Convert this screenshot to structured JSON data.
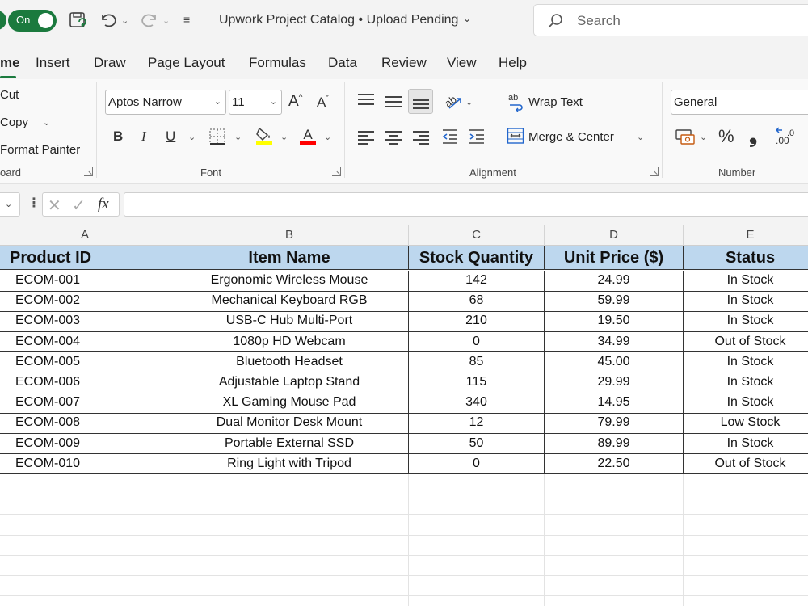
{
  "titlebar": {
    "autosave_label": "On",
    "doc_title": "Upwork Project Catalog",
    "doc_status": "Upload Pending",
    "search_placeholder": "Search"
  },
  "menu": {
    "tabs": [
      "me",
      "Insert",
      "Draw",
      "Page Layout",
      "Formulas",
      "Data",
      "Review",
      "View",
      "Help"
    ]
  },
  "ribbon": {
    "clipboard": {
      "cut": "Cut",
      "copy": "Copy",
      "format_painter": "Format Painter",
      "group_label": "oard"
    },
    "font": {
      "family": "Aptos Narrow",
      "size": "11",
      "bold": "B",
      "italic": "I",
      "underline": "U",
      "group_label": "Font",
      "highlight_color": "#ffff00",
      "font_color": "#ff0000"
    },
    "alignment": {
      "wrap_text": "Wrap Text",
      "merge_center": "Merge & Center",
      "group_label": "Alignment"
    },
    "number": {
      "format": "General",
      "percent": "%",
      "comma": "❟",
      "group_label": "Number"
    }
  },
  "formula_bar": {
    "fx": "fx",
    "value": ""
  },
  "sheet": {
    "column_letters": [
      "A",
      "B",
      "C",
      "D",
      "E"
    ],
    "headers": [
      "Product ID",
      "Item Name",
      "Stock Quantity",
      "Unit Price ($)",
      "Status"
    ],
    "rows": [
      [
        "ECOM-001",
        "Ergonomic Wireless Mouse",
        "142",
        "24.99",
        "In Stock"
      ],
      [
        "ECOM-002",
        "Mechanical Keyboard RGB",
        "68",
        "59.99",
        "In Stock"
      ],
      [
        "ECOM-003",
        "USB-C Hub Multi-Port",
        "210",
        "19.50",
        "In Stock"
      ],
      [
        "ECOM-004",
        "1080p HD Webcam",
        "0",
        "34.99",
        "Out of Stock"
      ],
      [
        "ECOM-005",
        "Bluetooth Headset",
        "85",
        "45.00",
        "In Stock"
      ],
      [
        "ECOM-006",
        "Adjustable Laptop Stand",
        "115",
        "29.99",
        "In Stock"
      ],
      [
        "ECOM-007",
        "XL Gaming Mouse Pad",
        "340",
        "14.95",
        "In Stock"
      ],
      [
        "ECOM-008",
        "Dual Monitor Desk Mount",
        "12",
        "79.99",
        "Low Stock"
      ],
      [
        "ECOM-009",
        "Portable External SSD",
        "50",
        "89.99",
        "In Stock"
      ],
      [
        "ECOM-010",
        "Ring Light with Tripod",
        "0",
        "22.50",
        "Out of Stock"
      ]
    ],
    "header_fill": "#bdd7ee",
    "empty_rows": 7
  }
}
